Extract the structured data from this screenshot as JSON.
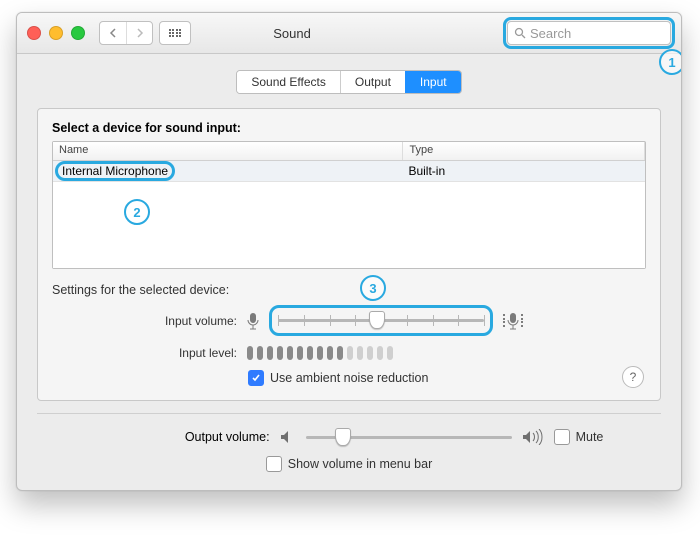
{
  "window": {
    "title": "Sound"
  },
  "search": {
    "placeholder": "Search"
  },
  "tabs": {
    "effects": "Sound Effects",
    "output": "Output",
    "input": "Input"
  },
  "panel": {
    "select_label": "Select a device for sound input:",
    "col_name": "Name",
    "col_type": "Type",
    "device_name": "Internal Microphone",
    "device_type": "Built-in",
    "settings_label": "Settings for the selected device:",
    "input_volume_label": "Input volume:",
    "input_level_label": "Input level:",
    "ambient_label": "Use ambient noise reduction"
  },
  "output": {
    "label": "Output volume:",
    "mute": "Mute",
    "menubar": "Show volume in menu bar"
  },
  "annotations": {
    "a1": "1",
    "a2": "2",
    "a3": "3"
  },
  "help": "?"
}
